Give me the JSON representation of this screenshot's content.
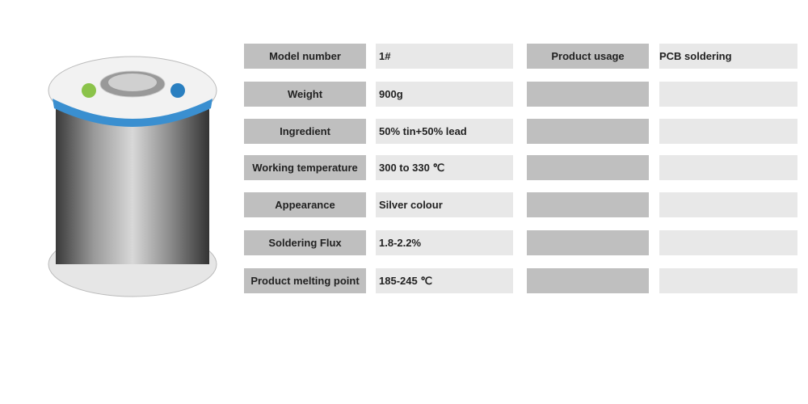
{
  "specs": [
    {
      "label": "Model number",
      "value": "1#"
    },
    {
      "label": "Weight",
      "value": "900g"
    },
    {
      "label": "Ingredient",
      "value": "50% tin+50% lead"
    },
    {
      "label": "Working temperature",
      "value": "300 to 330 ℃"
    },
    {
      "label": "Appearance",
      "value": "Silver colour"
    },
    {
      "label": "Soldering Flux",
      "value": "1.8-2.2%"
    },
    {
      "label": "Product melting point",
      "value": "185-245 ℃"
    }
  ],
  "specs_right": [
    {
      "label": "Product usage",
      "value": "PCB soldering"
    }
  ],
  "colors": {
    "label_bg": "#bfbfbf",
    "value_bg": "#e8e8e8",
    "spool_label": "#3a8fd0"
  }
}
